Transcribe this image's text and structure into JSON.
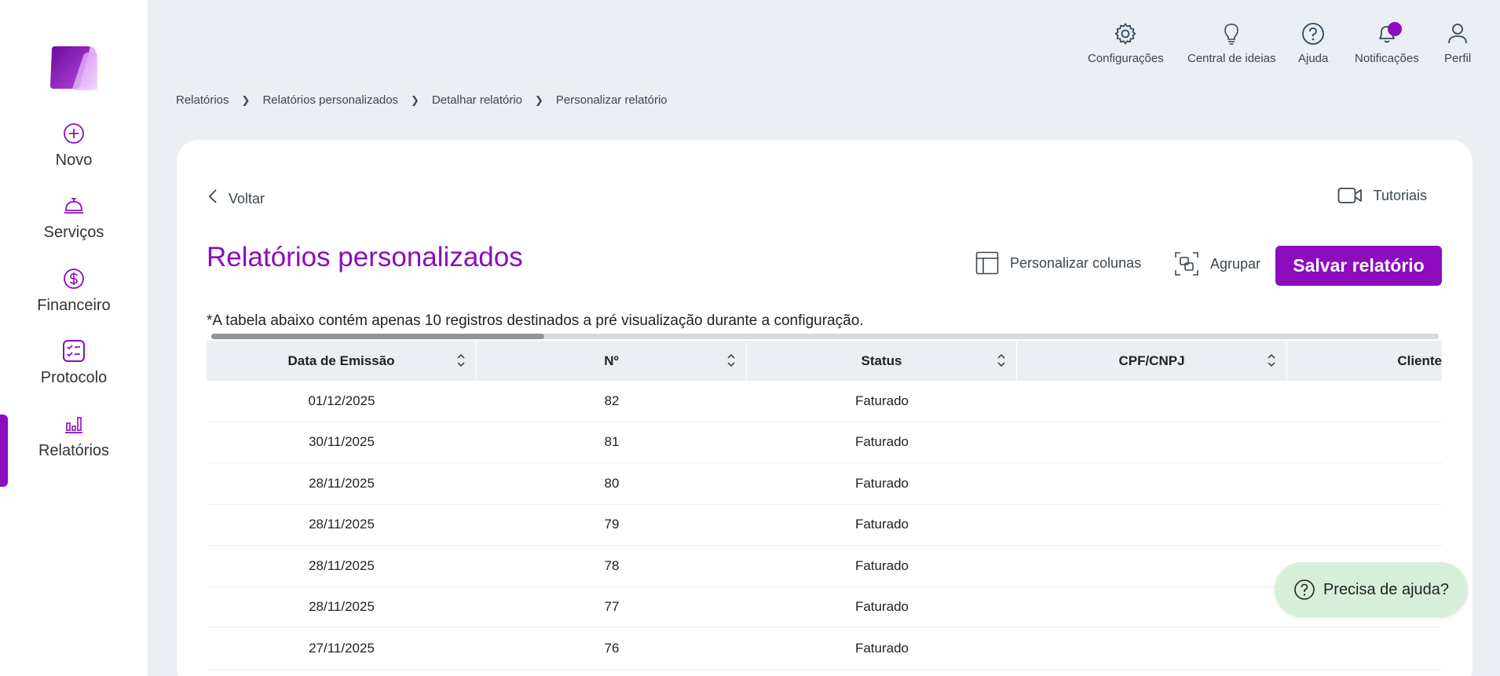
{
  "colors": {
    "accent": "#8e0cbd",
    "background": "#ebeef2",
    "help_bg": "#d6efd9"
  },
  "sidebar": {
    "items": [
      {
        "label": "Novo",
        "icon": "plus-circle-icon"
      },
      {
        "label": "Serviços",
        "icon": "bell-desk-icon"
      },
      {
        "label": "Financeiro",
        "icon": "dollar-circle-icon"
      },
      {
        "label": "Protocolo",
        "icon": "checklist-icon"
      },
      {
        "label": "Relatórios",
        "icon": "bar-chart-icon",
        "active": true
      }
    ]
  },
  "topbar": {
    "settings": "Configurações",
    "ideas": "Central de ideias",
    "help": "Ajuda",
    "notifications": "Notificações",
    "profile": "Perfil"
  },
  "breadcrumb": [
    "Relatórios",
    "Relatórios personalizados",
    "Detalhar relatório",
    "Personalizar relatório"
  ],
  "card": {
    "back_label": "Voltar",
    "tutorials_label": "Tutoriais",
    "title": "Relatórios personalizados",
    "customize_columns_label": "Personalizar colunas",
    "group_label": "Agrupar",
    "save_label": "Salvar relatório",
    "note": "*A tabela abaixo contém apenas 10 registros destinados a pré visualização durante a configuração."
  },
  "table": {
    "columns": [
      "Data de Emissão",
      "Nº",
      "Status",
      "CPF/CNPJ",
      "Cliente"
    ],
    "rows": [
      [
        "01/12/2025",
        "82",
        "Faturado",
        "",
        ""
      ],
      [
        "30/11/2025",
        "81",
        "Faturado",
        "",
        ""
      ],
      [
        "28/11/2025",
        "80",
        "Faturado",
        "",
        ""
      ],
      [
        "28/11/2025",
        "79",
        "Faturado",
        "",
        ""
      ],
      [
        "28/11/2025",
        "78",
        "Faturado",
        "",
        ""
      ],
      [
        "28/11/2025",
        "77",
        "Faturado",
        "",
        ""
      ],
      [
        "27/11/2025",
        "76",
        "Faturado",
        "",
        ""
      ]
    ]
  },
  "help_bubble": {
    "label": "Precisa de ajuda?"
  }
}
